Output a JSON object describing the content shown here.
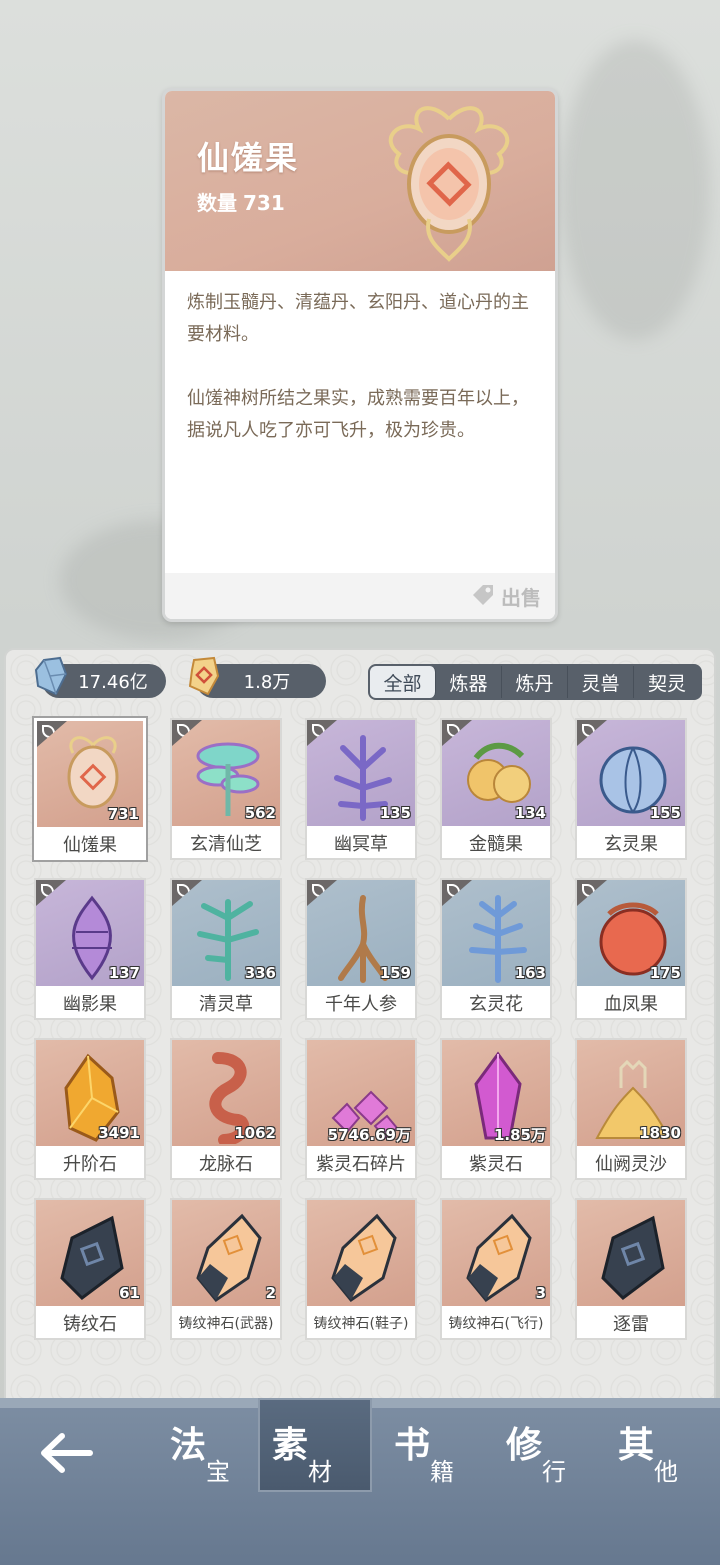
{
  "detail": {
    "title": "仙馐果",
    "qty_label": "数量",
    "qty_value": "731",
    "desc1": "炼制玉髓丹、清蕴丹、玄阳丹、道心丹的主要材料。",
    "desc2": "仙馐神树所结之果实，成熟需要百年以上，据说凡人吃了亦可飞升，极为珍贵。",
    "sell_label": "出售"
  },
  "currency": {
    "spirit_stone": "17.46亿",
    "gold": "1.8万"
  },
  "filters": [
    "全部",
    "炼器",
    "炼丹",
    "灵兽",
    "契灵"
  ],
  "items": [
    {
      "name": "仙馐果",
      "count": "731",
      "bg": "orange",
      "leaf": true,
      "icon": "golden-fruit-icon"
    },
    {
      "name": "玄清仙芝",
      "count": "562",
      "bg": "orange",
      "leaf": true,
      "icon": "mushroom-icon"
    },
    {
      "name": "幽冥草",
      "count": "135",
      "bg": "purple",
      "leaf": true,
      "icon": "purple-herb-icon"
    },
    {
      "name": "金髓果",
      "count": "134",
      "bg": "purple",
      "leaf": true,
      "icon": "golden-berry-icon"
    },
    {
      "name": "玄灵果",
      "count": "155",
      "bg": "purple",
      "leaf": true,
      "icon": "blue-fruit-icon"
    },
    {
      "name": "幽影果",
      "count": "137",
      "bg": "purple",
      "leaf": true,
      "icon": "shadow-fruit-icon"
    },
    {
      "name": "清灵草",
      "count": "336",
      "bg": "blue",
      "leaf": true,
      "icon": "green-herb-icon"
    },
    {
      "name": "千年人参",
      "count": "159",
      "bg": "blue",
      "leaf": true,
      "icon": "ginseng-icon"
    },
    {
      "name": "玄灵花",
      "count": "163",
      "bg": "blue",
      "leaf": true,
      "icon": "blue-flower-icon"
    },
    {
      "name": "血凤果",
      "count": "175",
      "bg": "blue",
      "leaf": true,
      "icon": "red-fruit-icon"
    },
    {
      "name": "升阶石",
      "count": "3491",
      "bg": "orange",
      "leaf": false,
      "icon": "amber-stone-icon"
    },
    {
      "name": "龙脉石",
      "count": "1062",
      "bg": "orange",
      "leaf": false,
      "icon": "dragon-stone-icon"
    },
    {
      "name": "紫灵石碎片",
      "count": "5746.69万",
      "bg": "orange",
      "leaf": false,
      "icon": "crystal-shards-icon"
    },
    {
      "name": "紫灵石",
      "count": "1.85万",
      "bg": "orange",
      "leaf": false,
      "icon": "purple-crystal-icon"
    },
    {
      "name": "仙阙灵沙",
      "count": "1830",
      "bg": "orange",
      "leaf": false,
      "icon": "sand-pile-icon"
    },
    {
      "name": "铸纹石",
      "count": "61",
      "bg": "orange",
      "leaf": false,
      "icon": "rune-stone-icon"
    },
    {
      "name": "铸纹神石(武器)",
      "count": "2",
      "bg": "orange",
      "leaf": false,
      "icon": "rune-crystal-icon"
    },
    {
      "name": "铸纹神石(鞋子)",
      "count": "",
      "bg": "orange",
      "leaf": false,
      "icon": "rune-crystal-icon"
    },
    {
      "name": "铸纹神石(飞行)",
      "count": "3",
      "bg": "orange",
      "leaf": false,
      "icon": "rune-crystal-icon"
    },
    {
      "name": "逐雷",
      "count": "",
      "bg": "orange",
      "leaf": false,
      "icon": "rune-stone-icon"
    }
  ],
  "nav": [
    {
      "big": "法",
      "small": "宝"
    },
    {
      "big": "素",
      "small": "材"
    },
    {
      "big": "书",
      "small": "籍"
    },
    {
      "big": "修",
      "small": "行"
    },
    {
      "big": "其",
      "small": "他"
    }
  ]
}
